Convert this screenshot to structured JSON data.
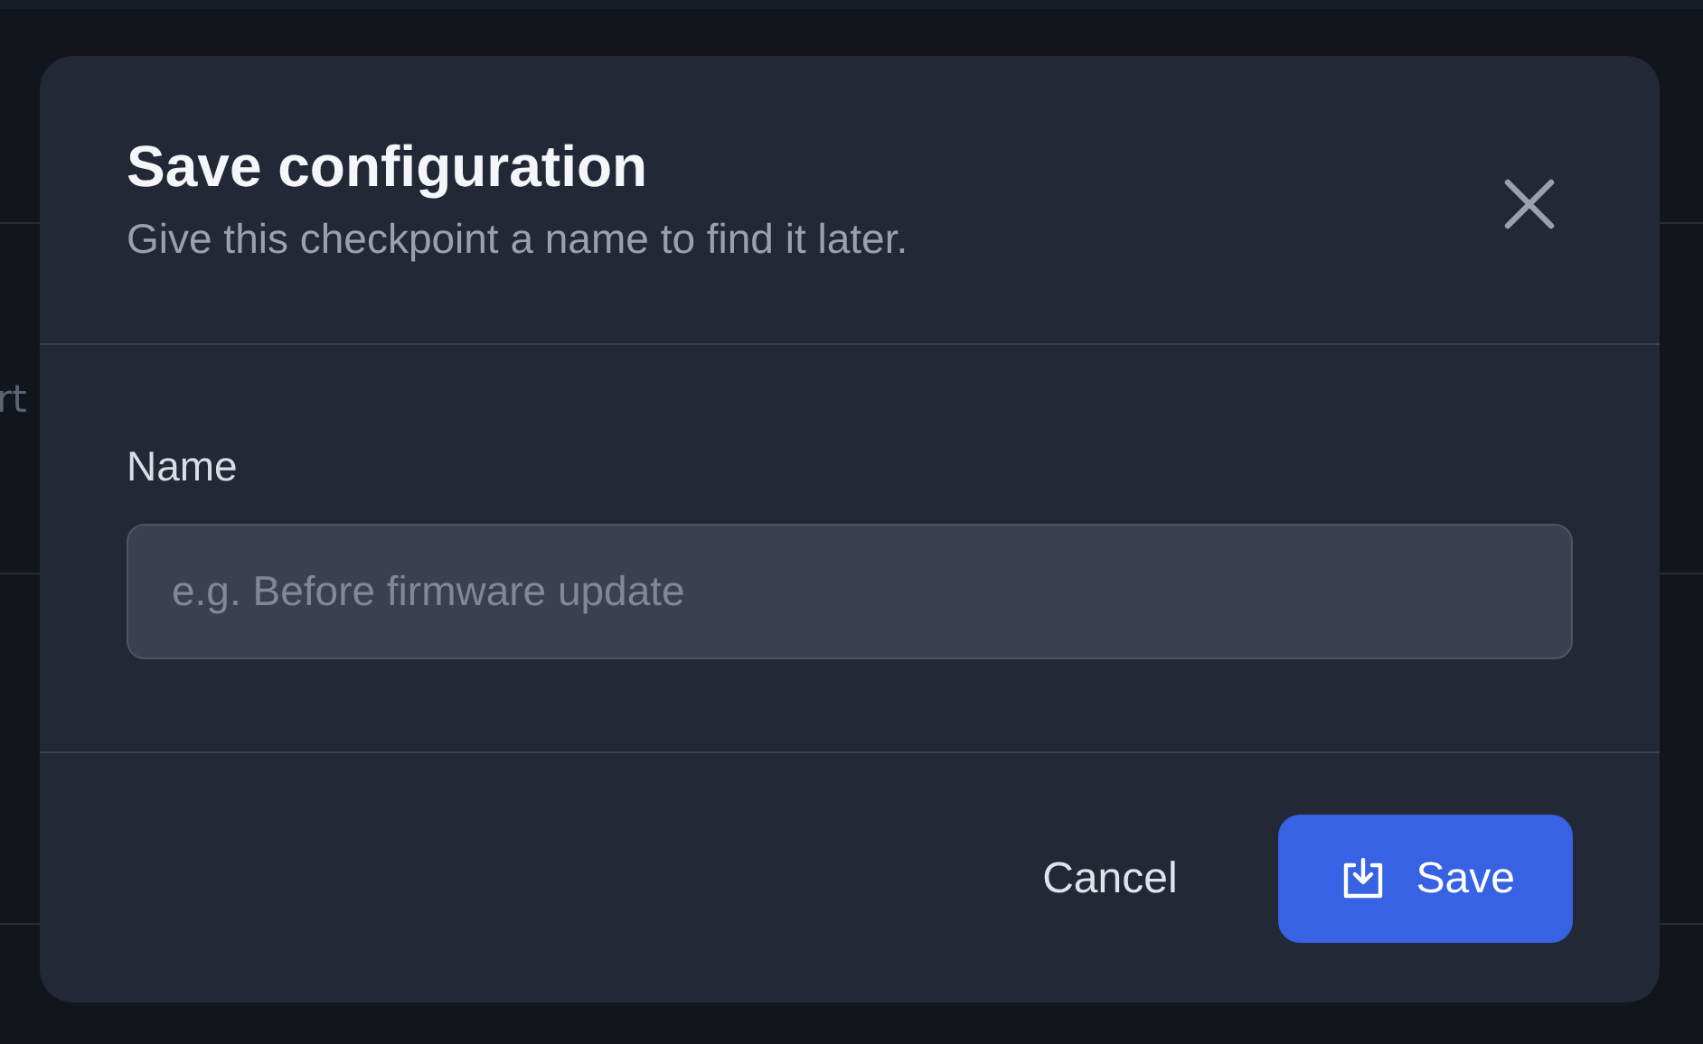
{
  "background": {
    "fragment": "rt"
  },
  "dialog": {
    "title": "Save configuration",
    "subtitle": "Give this checkpoint a name to find it later.",
    "field": {
      "label": "Name",
      "placeholder": "e.g. Before firmware update"
    },
    "buttons": [
      {
        "label": "Cancel",
        "kind": "secondary"
      },
      {
        "label": "Save",
        "kind": "primary"
      }
    ]
  }
}
